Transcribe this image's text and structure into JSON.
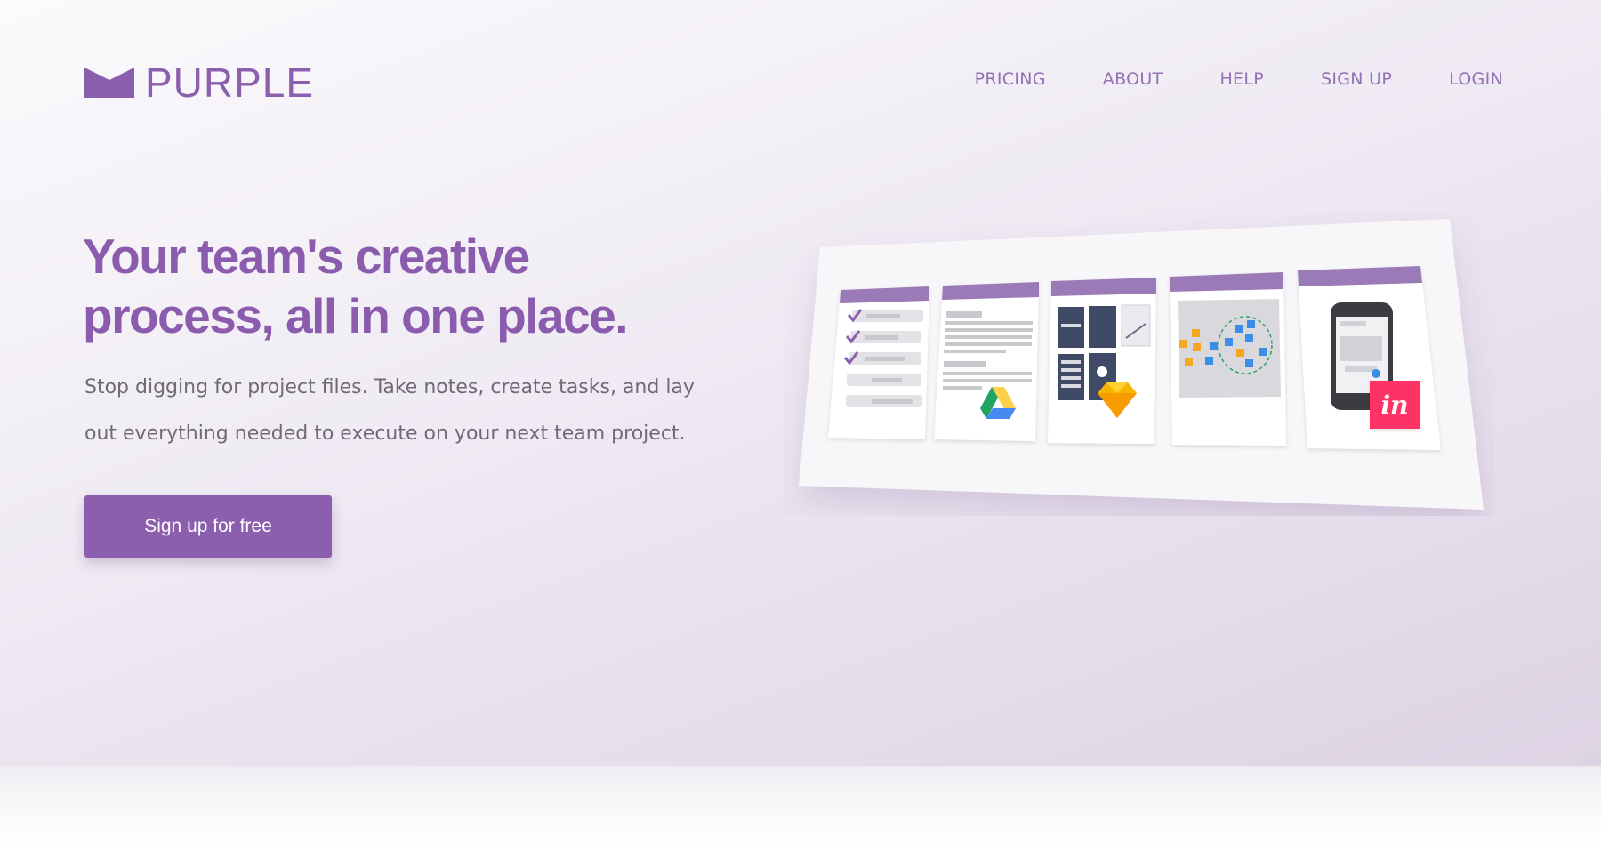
{
  "brand": {
    "name": "PURPLE",
    "logo_icon": "envelope-m-icon",
    "color": "#8a5fae"
  },
  "nav": {
    "items": [
      {
        "label": "PRICING"
      },
      {
        "label": "ABOUT"
      },
      {
        "label": "HELP"
      },
      {
        "label": "SIGN UP"
      },
      {
        "label": "LOGIN"
      }
    ]
  },
  "hero": {
    "headline": "Your team's creative process, all in one place.",
    "subtext": "Stop digging for project files. Take notes, create tasks, and lay out everything needed to execute on your next team project.",
    "cta_label": "Sign up for free"
  },
  "illustration": {
    "board_cards": [
      {
        "kind": "checklist-card"
      },
      {
        "kind": "notes-card",
        "icon": "google-drive-icon"
      },
      {
        "kind": "wireframes-card",
        "icon": "sketch-icon"
      },
      {
        "kind": "flowchart-card"
      },
      {
        "kind": "mobile-prototype-card",
        "icon": "invision-icon",
        "badge_text": "in"
      }
    ]
  },
  "colors": {
    "accent": "#8c5eae",
    "card_header": "#9b7ab8",
    "invision": "#ff3366",
    "drive_green": "#1fa463",
    "drive_yellow": "#ffd04b",
    "drive_blue": "#4688f4",
    "sketch_orange": "#f7b500"
  }
}
